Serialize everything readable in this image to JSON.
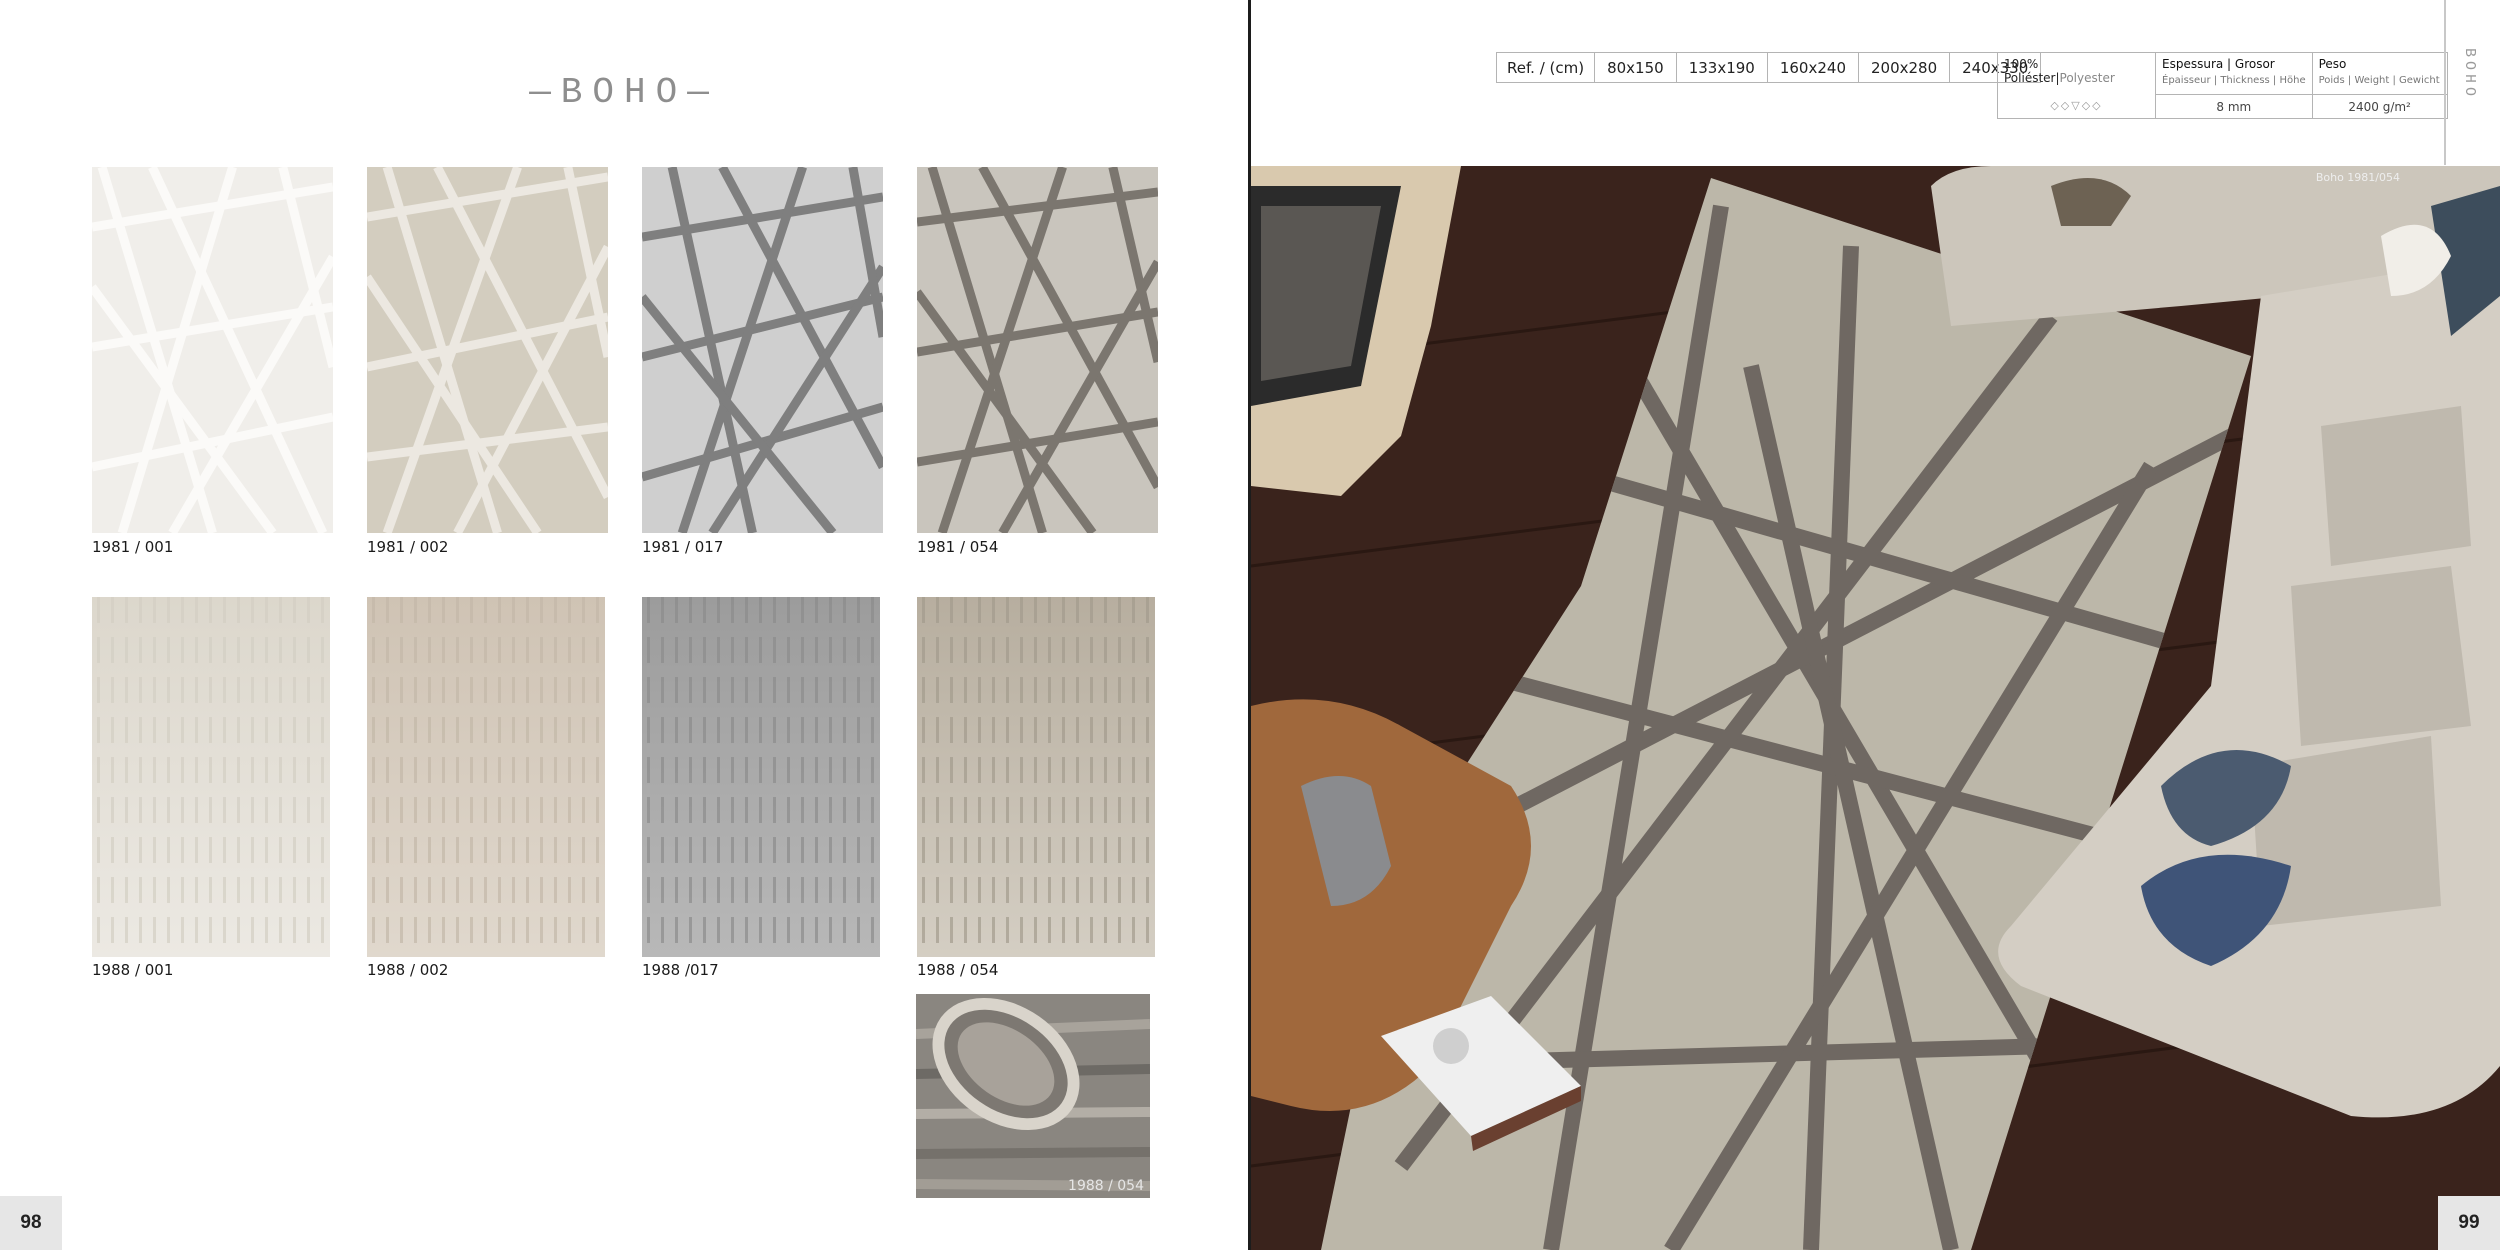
{
  "left_page": {
    "collection_title": "—BOHO—",
    "page_number": "98",
    "swatches": [
      {
        "label": "1981 / 001",
        "colors": {
          "base": "#f0eeea",
          "line": "#fbfaf8"
        }
      },
      {
        "label": "1981 / 002",
        "colors": {
          "base": "#d3cdbf",
          "line": "#ece8e1"
        }
      },
      {
        "label": "1981 / 017",
        "colors": {
          "base": "#cfcfcf",
          "line": "#7f7f7f"
        }
      },
      {
        "label": "1981 / 054",
        "colors": {
          "base": "#c9c5bd",
          "line": "#7b766f"
        }
      },
      {
        "label": "1988 / 001",
        "colors": {
          "base": "#e5e1d8",
          "line": "#d4cfc4"
        }
      },
      {
        "label": "1988 / 002",
        "colors": {
          "base": "#d9cfc2",
          "line": "#c4b8a8"
        }
      },
      {
        "label": "1988 /017",
        "colors": {
          "base": "#a9a9a9",
          "line": "#8c8c8c"
        }
      },
      {
        "label": "1988 / 054",
        "colors": {
          "base": "#c8c1b4",
          "line": "#a39b8e"
        }
      }
    ],
    "detail_photo": {
      "caption": "1988 / 054"
    }
  },
  "right_page": {
    "page_number": "99",
    "vertical_tag": "BOHO",
    "size_table": {
      "ref_label": "Ref. / (cm)",
      "sizes": [
        "80x150",
        "133x190",
        "160x240",
        "200x280",
        "240x330"
      ]
    },
    "spec_table": {
      "material_es": "100% Poliéster",
      "material_en": "Polyester",
      "care_icons": "◇◇▽◇◇",
      "thickness_title": "Espessura | Grosor",
      "thickness_sub": "Épaisseur | Thickness  |  Höhe",
      "thickness_value": "8 mm",
      "weight_title": "Peso",
      "weight_sub": "Poids | Weight  |  Gewicht",
      "weight_value": "2400 g/m²"
    },
    "room_photo": {
      "caption": "Boho 1981/054"
    }
  }
}
